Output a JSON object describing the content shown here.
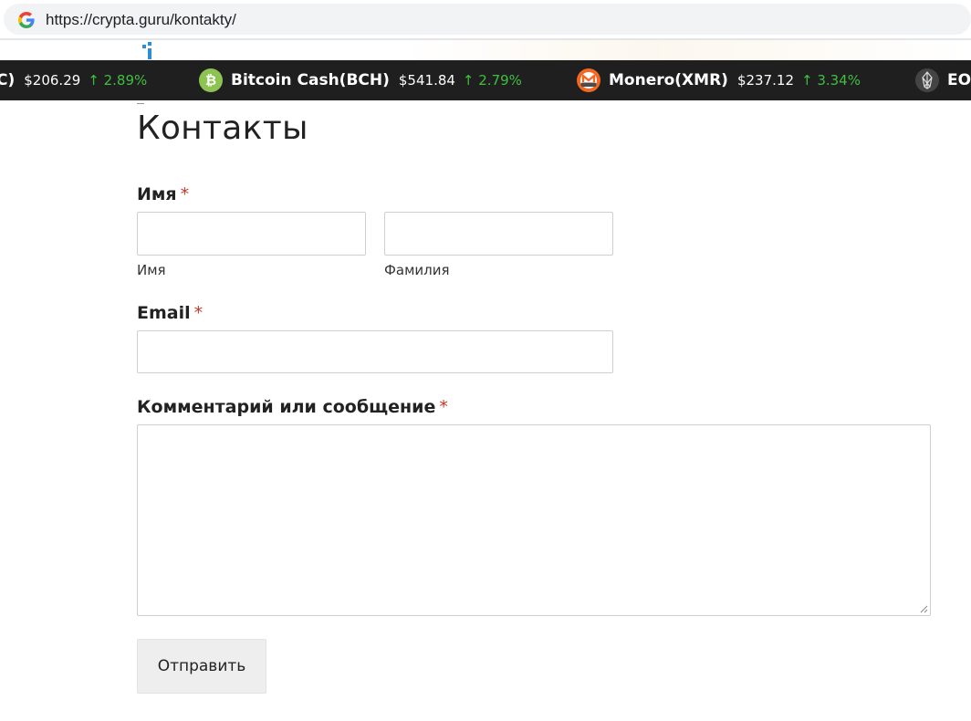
{
  "browser": {
    "url": "https://crypta.guru/kontakty/"
  },
  "ticker": {
    "items": [
      {
        "name": "C)",
        "price": "$206.29",
        "change": "↑ 2.89%",
        "icon": "partial"
      },
      {
        "name": "Bitcoin Cash(BCH)",
        "price": "$541.84",
        "change": "↑ 2.79%",
        "icon": "bitcoin-cash-icon",
        "color": "#8dc351"
      },
      {
        "name": "Monero(XMR)",
        "price": "$237.12",
        "change": "↑ 3.34%",
        "icon": "monero-icon",
        "color": "#f26822"
      },
      {
        "name": "EO",
        "icon": "eos-icon",
        "color": "#444444"
      }
    ],
    "up_color": "#3fbf3f",
    "background": "#1f1f1f"
  },
  "page": {
    "title": "Контакты"
  },
  "form": {
    "name": {
      "label": "Имя",
      "required_mark": "*",
      "first_sublabel": "Имя",
      "last_sublabel": "Фамилия"
    },
    "email": {
      "label": "Email",
      "required_mark": "*"
    },
    "comment": {
      "label": "Комментарий или сообщение",
      "required_mark": "*"
    },
    "submit_label": "Отправить"
  }
}
